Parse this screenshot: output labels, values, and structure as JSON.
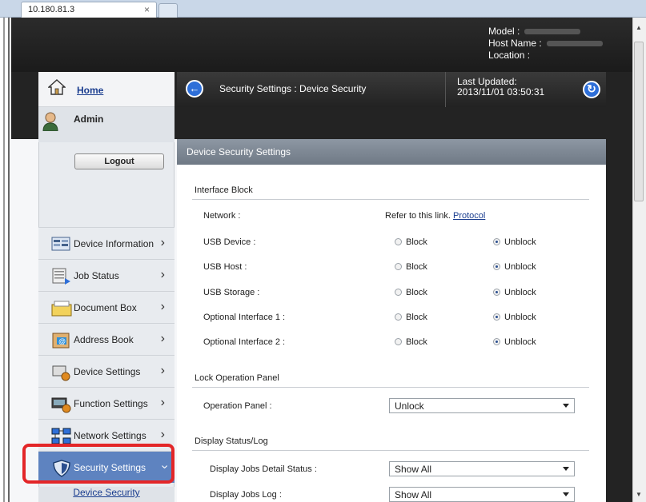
{
  "browser": {
    "tab_title": "10.180.81.3",
    "tab_close": "×"
  },
  "header": {
    "model_label": "Model :",
    "host_label": "Host Name :",
    "location_label": "Location :"
  },
  "sidebar": {
    "home": "Home",
    "admin": "Admin",
    "logout": "Logout",
    "items": [
      {
        "label": "Device Information",
        "icon": "device-information-icon"
      },
      {
        "label": "Job Status",
        "icon": "job-status-icon"
      },
      {
        "label": "Document Box",
        "icon": "document-box-icon"
      },
      {
        "label": "Address Book",
        "icon": "address-book-icon"
      },
      {
        "label": "Device Settings",
        "icon": "device-settings-icon"
      },
      {
        "label": "Function Settings",
        "icon": "function-settings-icon"
      },
      {
        "label": "Network Settings",
        "icon": "network-settings-icon"
      },
      {
        "label": "Security Settings",
        "icon": "security-settings-icon"
      }
    ],
    "sub_item": "Device Security"
  },
  "titlebar": {
    "breadcrumb": "Security Settings : Device Security",
    "last_updated_label": "Last Updated:",
    "last_updated_value": "2013/11/01 03:50:31"
  },
  "section": {
    "title": "Device Security Settings"
  },
  "interface_block": {
    "title": "Interface Block",
    "network_label": "Network :",
    "network_text": "Refer to this link.",
    "network_link": "Protocol",
    "rows": [
      {
        "label": "USB Device :",
        "block": "Block",
        "unblock": "Unblock"
      },
      {
        "label": "USB Host :",
        "block": "Block",
        "unblock": "Unblock"
      },
      {
        "label": "USB Storage :",
        "block": "Block",
        "unblock": "Unblock"
      },
      {
        "label": "Optional Interface 1 :",
        "block": "Block",
        "unblock": "Unblock"
      },
      {
        "label": "Optional Interface 2 :",
        "block": "Block",
        "unblock": "Unblock"
      }
    ]
  },
  "lock_panel": {
    "title": "Lock Operation Panel",
    "label": "Operation Panel :",
    "value": "Unlock"
  },
  "display_status": {
    "title": "Display Status/Log",
    "rows": [
      {
        "label": "Display Jobs Detail Status :",
        "value": "Show All"
      },
      {
        "label": "Display Jobs Log :",
        "value": "Show All"
      }
    ]
  },
  "colors": {
    "active_nav": "#5e83c0",
    "highlight": "#e32628",
    "accent_button": "#2e6fd8"
  }
}
